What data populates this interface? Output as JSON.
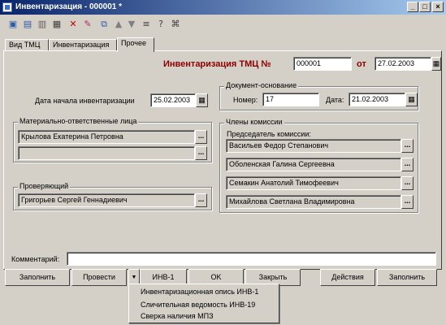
{
  "window": {
    "title": "Инвентаризация - 000001 *",
    "minimize": "_",
    "maximize": "□",
    "close": "×"
  },
  "toolbar_icons": [
    "save-icon",
    "save-close-icon",
    "new-icon",
    "print-icon",
    "delete-icon",
    "edit-icon",
    "copy-icon",
    "up-arrow-icon",
    "down-arrow-icon",
    "list-icon",
    "help-icon",
    "info-icon"
  ],
  "tabs": [
    "Вид ТМЦ",
    "Инвентаризация",
    "Прочее"
  ],
  "header": {
    "title": "Инвентаризация ТМЦ №",
    "number": "000001",
    "date_label": "от",
    "date": "27.02.2003"
  },
  "start_date": {
    "label": "Дата начала инвентаризации",
    "value": "25.02.2003"
  },
  "basis": {
    "legend": "Документ-основание",
    "number_label": "Номер:",
    "number": "17",
    "date_label": "Дата:",
    "date": "21.02.2003"
  },
  "responsible": {
    "legend": "Материально-ответственные лица",
    "items": [
      "Крылова Екатерина Петровна",
      ""
    ]
  },
  "checker": {
    "legend": "Проверяющий",
    "value": "Григорьев Сергей Геннадиевич"
  },
  "commission": {
    "legend": "Члены комиссии",
    "chairman_label": "Председатель комиссии:",
    "members": [
      "Васильев Федор Степанович",
      "Оболенская Галина Сергеевна",
      "Семакин Анатолий Тимофеевич",
      "Михайлова Светлана Владимировна"
    ]
  },
  "comment": {
    "label": "Комментарий:",
    "value": ""
  },
  "buttons": {
    "fill": "Заполнить",
    "post": "Провести",
    "dropdown": "▼",
    "inv1": "ИНВ-1",
    "ok": "OK",
    "close": "Закрыть",
    "actions": "Действия",
    "fill2": "Заполнить"
  },
  "print_menu": [
    "Инвентаризационная опись ИНВ-1",
    "Сличительная ведомость ИНВ-19",
    "Сверка наличия МПЗ"
  ]
}
